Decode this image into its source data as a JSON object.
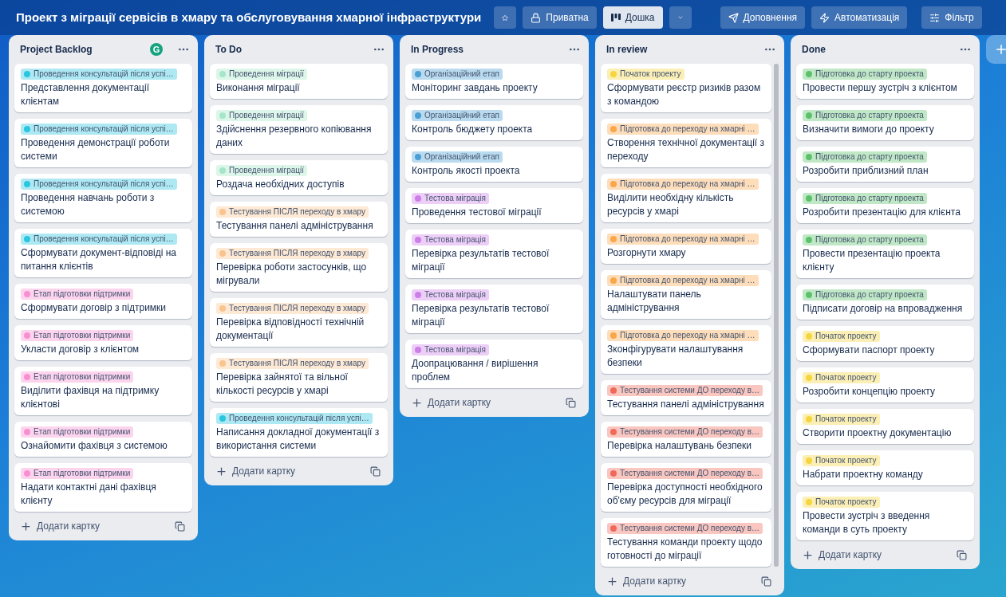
{
  "board": {
    "title": "Проект з міграції сервісів в хмару та обслуговування хмарної інфраструктури"
  },
  "toolbar": [
    {
      "kind": "star"
    },
    {
      "kind": "lock",
      "label": "Приватна"
    },
    {
      "kind": "view",
      "label": "Дошка",
      "selected": true
    },
    {
      "kind": "chevron"
    },
    {
      "kind": "send",
      "label": "Доповнення"
    },
    {
      "kind": "bolt",
      "label": "Автоматизація"
    },
    {
      "kind": "filter",
      "label": "Фільтр"
    }
  ],
  "lists": [
    {
      "title": "Project Backlog",
      "badge": "G",
      "add_label": "Додати картку",
      "scrollbar": false,
      "cards": [
        {
          "label": "Проведення консультацій після успі…",
          "color": "#29c6e0",
          "title": "Представлення документації клієнтам"
        },
        {
          "label": "Проведення консультацій після успі…",
          "color": "#29c6e0",
          "title": "Проведення демонстрації роботи системи"
        },
        {
          "label": "Проведення консультацій після успі…",
          "color": "#29c6e0",
          "title": "Проведення навчань роботи з системою"
        },
        {
          "label": "Проведення консультацій після успі…",
          "color": "#29c6e0",
          "title": "Сформувати документ-відповіді на питання клієнтів"
        },
        {
          "label": "Етап підготовки підтримки",
          "color": "#f98fd2",
          "title": "Сформувати договір з підтримки"
        },
        {
          "label": "Етап підготовки підтримки",
          "color": "#f98fd2",
          "title": "Укласти договір з клієнтом"
        },
        {
          "label": "Етап підготовки підтримки",
          "color": "#f98fd2",
          "title": "Виділити фахівця на підтримку клієнтові"
        },
        {
          "label": "Етап підготовки підтримки",
          "color": "#f98fd2",
          "title": "Ознайомити фахівця з системою"
        },
        {
          "label": "Етап підготовки підтримки",
          "color": "#f98fd2",
          "title": "Надати контактні дані фахівця клієнту"
        }
      ]
    },
    {
      "title": "To Do",
      "add_label": "Додати картку",
      "scrollbar": false,
      "cards": [
        {
          "label": "Проведення міграції",
          "color": "#a6e6c8",
          "title": "Виконання міграції"
        },
        {
          "label": "Проведення міграції",
          "color": "#a6e6c8",
          "title": "Здійснення резервного копіювання даних"
        },
        {
          "label": "Проведення міграції",
          "color": "#a6e6c8",
          "title": "Роздача необхідних доступів"
        },
        {
          "label": "Тестування ПІСЛЯ переходу в хмару",
          "color": "#f9c48e",
          "title": "Тестування панелі адміністрування"
        },
        {
          "label": "Тестування ПІСЛЯ переходу в хмару",
          "color": "#f9c48e",
          "title": "Перевірка роботи застосунків, що мігрували"
        },
        {
          "label": "Тестування ПІСЛЯ переходу в хмару",
          "color": "#f9c48e",
          "title": "Перевірка відповідності технічній документації"
        },
        {
          "label": "Тестування ПІСЛЯ переходу в хмару",
          "color": "#f9c48e",
          "title": "Перевірка зайнятої та вільної кількості ресурсів у хмарі"
        },
        {
          "label": "Проведення консультацій після успі…",
          "color": "#29c6e0",
          "title": "Написання докладної документації з використання системи"
        }
      ]
    },
    {
      "title": "In Progress",
      "add_label": "Додати картку",
      "scrollbar": false,
      "cards": [
        {
          "label": "Організаційний етап",
          "color": "#4a9fd5",
          "title": "Моніторинг завдань проекту"
        },
        {
          "label": "Організаційний етап",
          "color": "#4a9fd5",
          "title": "Контроль бюджету проекта"
        },
        {
          "label": "Організаційний етап",
          "color": "#4a9fd5",
          "title": "Контроль якості проекта"
        },
        {
          "label": "Тестова міграція",
          "color": "#cd7ee8",
          "title": "Проведення тестової міграції"
        },
        {
          "label": "Тестова міграція",
          "color": "#cd7ee8",
          "title": "Перевірка результатів тестової міграції"
        },
        {
          "label": "Тестова міграція",
          "color": "#cd7ee8",
          "title": "Перевірка результатів тестової міграції"
        },
        {
          "label": "Тестова міграція",
          "color": "#cd7ee8",
          "title": "Доопрацювання / вирішення проблем"
        }
      ]
    },
    {
      "title": "In review",
      "add_label": "Додати картку",
      "scrollbar": true,
      "cards": [
        {
          "label": "Початок проекту",
          "color": "#f5d63d",
          "title": "Сформувати реєстр ризиків разом з командою"
        },
        {
          "label": "Підготовка до переходу на хмарні …",
          "color": "#fba64a",
          "title": "Створення технічної документації з переходу"
        },
        {
          "label": "Підготовка до переходу на хмарні …",
          "color": "#fba64a",
          "title": "Виділити необхідну кількість ресурсів у хмарі"
        },
        {
          "label": "Підготовка до переходу на хмарні …",
          "color": "#fba64a",
          "title": "Розгорнути хмару"
        },
        {
          "label": "Підготовка до переходу на хмарні …",
          "color": "#fba64a",
          "title": "Налаштувати панель адміністрування"
        },
        {
          "label": "Підготовка до переходу на хмарні …",
          "color": "#fba64a",
          "title": "Зконфігурувати налаштування безпеки"
        },
        {
          "label": "Тестування системи ДО переходу в…",
          "color": "#ef6a5a",
          "title": "Тестування панелі адміністрування"
        },
        {
          "label": "Тестування системи ДО переходу в…",
          "color": "#ef6a5a",
          "title": "Перевірка налаштувань безпеки"
        },
        {
          "label": "Тестування системи ДО переходу в…",
          "color": "#ef6a5a",
          "title": "Перевірка доступності необхідного об'єму ресурсів для міграції"
        },
        {
          "label": "Тестування системи ДО переходу в…",
          "color": "#ef6a5a",
          "title": "Тестування команди проекту щодо готовності до міграції"
        }
      ]
    },
    {
      "title": "Done",
      "add_label": "Додати картку",
      "scrollbar": false,
      "cards": [
        {
          "label": "Підготовка до старту проекта",
          "color": "#5cc26a",
          "title": "Провести першу зустріч з клієнтом"
        },
        {
          "label": "Підготовка до старту проекта",
          "color": "#5cc26a",
          "title": "Визначити вимоги до проекту"
        },
        {
          "label": "Підготовка до старту проекта",
          "color": "#5cc26a",
          "title": "Розробити приблизний план"
        },
        {
          "label": "Підготовка до старту проекта",
          "color": "#5cc26a",
          "title": "Розробити презентацію для клієнта"
        },
        {
          "label": "Підготовка до старту проекта",
          "color": "#5cc26a",
          "title": "Провести презентацію проекта клієнту"
        },
        {
          "label": "Підготовка до старту проекта",
          "color": "#5cc26a",
          "title": "Підписати договір на впровадження"
        },
        {
          "label": "Початок проекту",
          "color": "#f5d63d",
          "title": "Сформувати паспорт проекту"
        },
        {
          "label": "Початок проекту",
          "color": "#f5d63d",
          "title": "Розробити концепцію проекту"
        },
        {
          "label": "Початок проекту",
          "color": "#f5d63d",
          "title": "Створити проектну документацію"
        },
        {
          "label": "Початок проекту",
          "color": "#f5d63d",
          "title": "Набрати проектну команду"
        },
        {
          "label": "Початок проекту",
          "color": "#f5d63d",
          "title": "Провести зустріч з введення команди в суть проекту"
        }
      ]
    }
  ],
  "add_list": {
    "kind": "plus"
  }
}
